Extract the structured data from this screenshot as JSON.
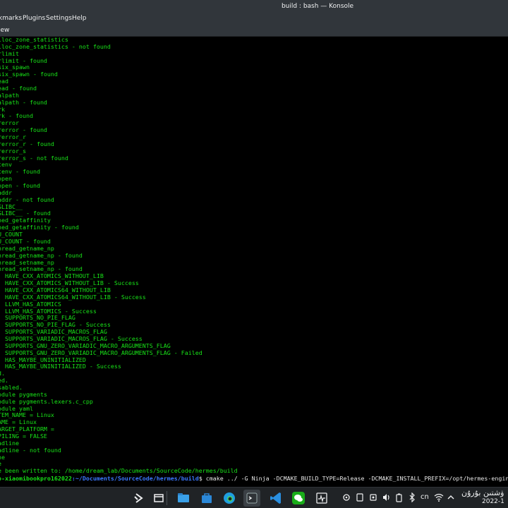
{
  "window": {
    "title": "build : bash — Konsole"
  },
  "menu": {
    "items": [
      "kmarks",
      "Plugins",
      "Settings",
      "Help"
    ],
    "view_label": "iew"
  },
  "terminal": {
    "lines": [
      "lloc_zone_statistics",
      "lloc_zone_statistics - not found",
      "rlimit",
      "rlimit - found",
      "six_spawn",
      "six_spawn - found",
      "ead",
      "ead - found",
      "alpath",
      "alpath - found",
      "rk",
      "rk - found",
      "rerror",
      "rerror - found",
      "rerror_r",
      "rerror_r - found",
      "rerror_s",
      "rerror_s - not found",
      "tenv",
      "tenv - found",
      "open",
      "open - found",
      "addr",
      "addr - not found",
      "GLIBC__",
      "GLIBC__ - found",
      "hed_getaffinity",
      "hed_getaffinity - found",
      "U_COUNT",
      "U_COUNT - found",
      "hread_getname_np",
      "hread_getname_np - found",
      "hread_setname_np",
      "hread_setname_np - found",
      ": HAVE_CXX_ATOMICS_WITHOUT_LIB",
      ": HAVE_CXX_ATOMICS_WITHOUT_LIB - Success",
      ": HAVE_CXX_ATOMICS64_WITHOUT_LIB",
      ": HAVE_CXX_ATOMICS64_WITHOUT_LIB - Success",
      ": LLVM_HAS_ATOMICS",
      ": LLVM_HAS_ATOMICS - Success",
      ": SUPPORTS_NO_PIE_FLAG",
      ": SUPPORTS_NO_PIE_FLAG - Success",
      ": SUPPORTS_VARIADIC_MACROS_FLAG",
      ": SUPPORTS_VARIADIC_MACROS_FLAG - Success",
      ": SUPPORTS_GNU_ZERO_VARIADIC_MACRO_ARGUMENTS_FLAG",
      ": SUPPORTS_GNU_ZERO_VARIADIC_MACRO_ARGUMENTS_FLAG - Failed",
      ": HAS_MAYBE_UNINITIALIZED",
      ": HAS_MAYBE_UNINITIALIZED - Success",
      "d.",
      "ed.",
      "sabled.",
      "odule pygments",
      "odule pygments.lexers.c_cpp",
      "odule yaml",
      "TEM_NAME = Linux",
      "AME = Linux",
      "ARGET_PLATFORM =",
      "PILING = FALSE",
      "adline",
      "adline - not found",
      "ne",
      "e",
      "e been written to: /home/dream_lab/Documents/SourceCode/hermes/build"
    ],
    "prompt": {
      "user_host": "o-xiaomibookpro162022",
      "path": ":~/Documents/SourceCode/hermes/build",
      "dollar": "$ ",
      "command": "cmake ../ -G Ninja -DCMAKE_BUILD_TYPE=Release -DCMAKE_INSTALL_PREFIX=/opt/hermes-engine"
    }
  },
  "taskbar": {
    "apps": [
      "app-launcher-icon",
      "panel-icon",
      "file-manager-icon",
      "store-icon",
      "edge-browser-icon",
      "konsole-icon",
      "vscode-icon",
      "wechat-icon",
      "system-monitor-icon"
    ],
    "ime_label": "cn",
    "clock_time": "ۋشتىن بۇرۇن",
    "clock_date": "2022-1"
  },
  "colors": {
    "terminal_green": "#18e418",
    "path_blue": "#3b78ff",
    "panel_bg": "#31363b",
    "taskbar_bg": "#202326"
  }
}
